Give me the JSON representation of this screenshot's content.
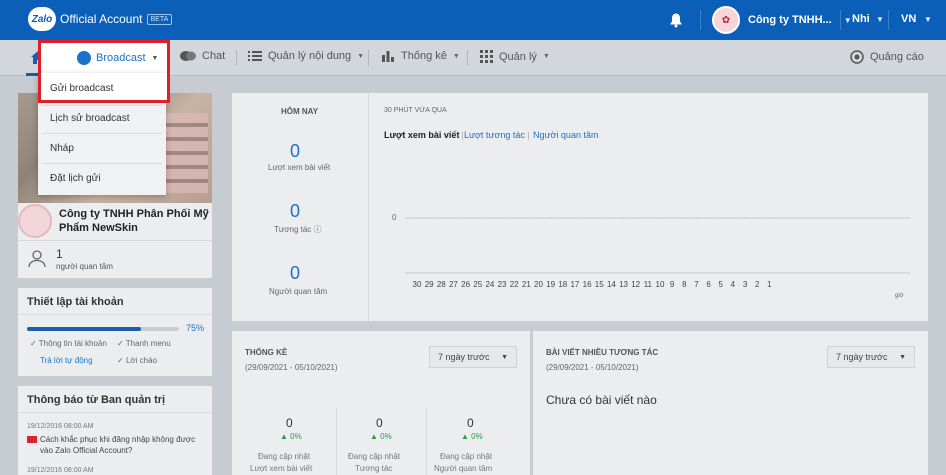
{
  "topbar": {
    "logo_badge": "Zalo",
    "logo_text": "Official Account",
    "beta": "BETA",
    "account_name": "Công ty TNHH...",
    "user": "Nhi",
    "lang": "VN"
  },
  "nav": {
    "broadcast": "Broadcast",
    "chat": "Chat",
    "content": "Quản lý nội dung",
    "stats": "Thống kê",
    "manage": "Quản lý",
    "ads": "Quảng cáo"
  },
  "dropdown": {
    "items": [
      "Gửi broadcast",
      "Lịch sử broadcast",
      "Nháp",
      "Đặt lịch gửi"
    ]
  },
  "profile": {
    "company": "Công ty TNHH Phân Phối Mỹ Phẩm NewSkin",
    "followers": "1",
    "followers_label": "người quan tâm"
  },
  "setup": {
    "title": "Thiết lập tài khoản",
    "progress_pct": "75%",
    "progress_value": 0.75,
    "items": [
      "Thông tin tài khoản",
      "Thanh menu",
      "Trả lời tự động",
      "Lời chào"
    ]
  },
  "notices": {
    "title": "Thông báo từ Ban quản trị",
    "date1": "19/12/2016 08:00 AM",
    "text1": "Cách khắc phục khi đăng nhập không được vào Zalo Official Account?",
    "date2": "19/12/2016 08:00 AM"
  },
  "today": {
    "title": "HÔM NAY",
    "views": "0",
    "views_label": "Lượt xem bài viết",
    "interactions": "0",
    "interactions_label": "Tương tác",
    "followers": "0",
    "followers_label": "Người quan tâm"
  },
  "chart": {
    "title": "30 PHÚT VỪA QUA",
    "tabs": [
      "Lượt xem bài viết",
      "Lượt tương tác",
      "Người quan tâm"
    ],
    "zero_label": "0",
    "ticks": [
      "30",
      "29",
      "28",
      "27",
      "26",
      "25",
      "24",
      "23",
      "22",
      "21",
      "20",
      "19",
      "18",
      "17",
      "16",
      "15",
      "14",
      "13",
      "12",
      "11",
      "10",
      "9",
      "8",
      "7",
      "6",
      "5",
      "4",
      "3",
      "2",
      "1"
    ],
    "ago_label": "giờ"
  },
  "chart_data": {
    "type": "line",
    "title": "30 PHÚT VỪA QUA",
    "x": [
      30,
      29,
      28,
      27,
      26,
      25,
      24,
      23,
      22,
      21,
      20,
      19,
      18,
      17,
      16,
      15,
      14,
      13,
      12,
      11,
      10,
      9,
      8,
      7,
      6,
      5,
      4,
      3,
      2,
      1
    ],
    "series": [
      {
        "name": "Lượt xem bài viết",
        "values": [
          0,
          0,
          0,
          0,
          0,
          0,
          0,
          0,
          0,
          0,
          0,
          0,
          0,
          0,
          0,
          0,
          0,
          0,
          0,
          0,
          0,
          0,
          0,
          0,
          0,
          0,
          0,
          0,
          0,
          0
        ]
      }
    ],
    "xlabel": "",
    "ylabel": "",
    "ylim": [
      0,
      1
    ]
  },
  "stats": {
    "title": "THỐNG KÊ",
    "range": "(29/09/2021 - 05/10/2021)",
    "select": "7 ngày trước",
    "metrics": [
      {
        "value": "0",
        "change": "▲ 0%",
        "cap1": "Đang cập nhật",
        "cap2": "Lượt xem bài viết"
      },
      {
        "value": "0",
        "change": "▲ 0%",
        "cap1": "Đang cập nhật",
        "cap2": "Tương tác"
      },
      {
        "value": "0",
        "change": "▲ 0%",
        "cap1": "Đang cập nhật",
        "cap2": "Người quan tâm"
      }
    ]
  },
  "top_posts": {
    "title": "BÀI VIẾT NHIỀU TƯƠNG TÁC",
    "range": "(29/09/2021 - 05/10/2021)",
    "select": "7 ngày trước",
    "empty": "Chưa có bài viết nào"
  }
}
